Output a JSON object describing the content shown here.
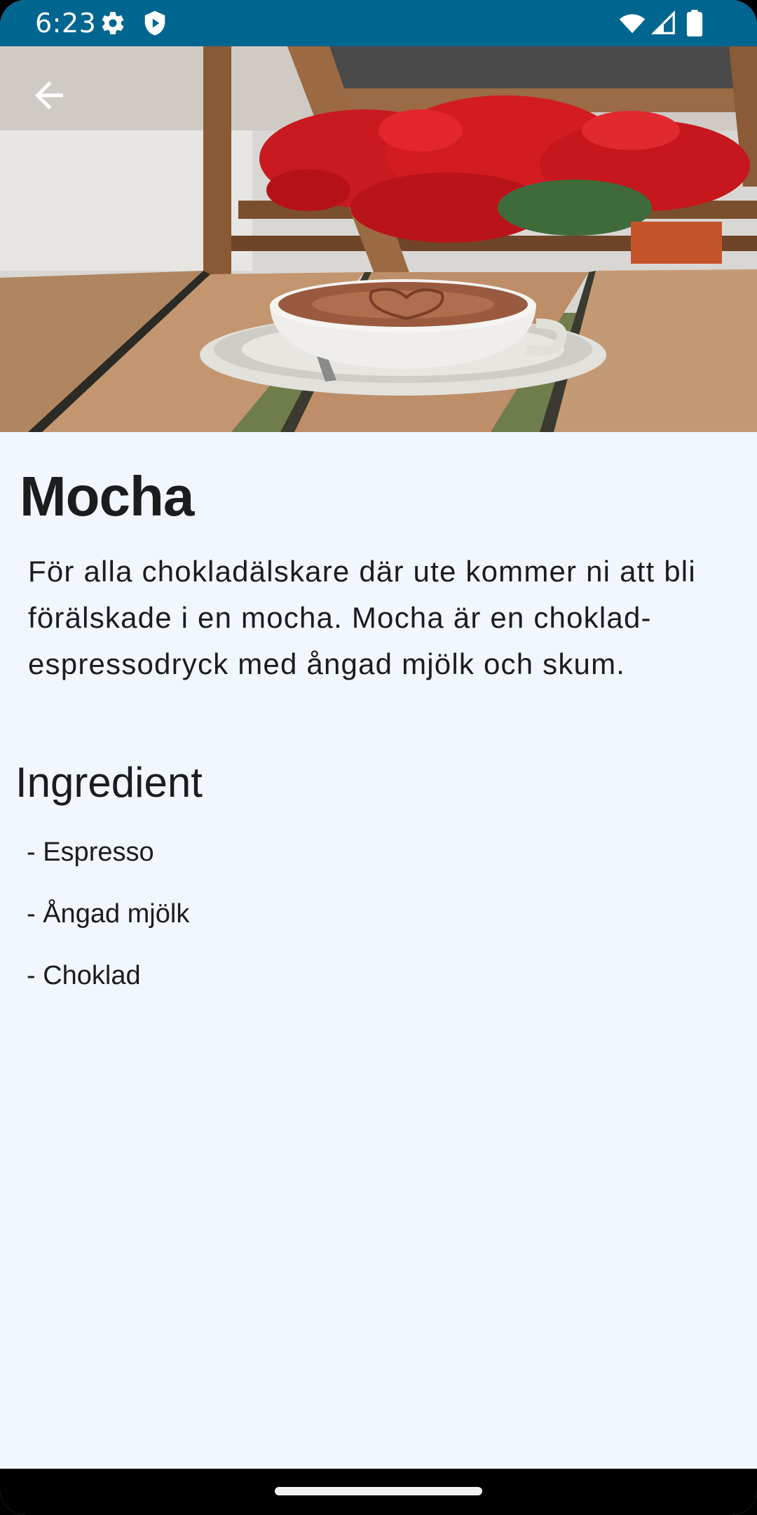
{
  "status_bar": {
    "time": "6:23",
    "icons": [
      "gear-icon",
      "shield-icon",
      "wifi-icon",
      "cellular-signal-icon",
      "battery-icon"
    ],
    "background": "#006690"
  },
  "hero": {
    "image": "mocha-cup-photo",
    "back_icon": "arrow-back-icon"
  },
  "content": {
    "title": "Mocha",
    "description": "För alla chokladälskare där ute kommer ni att bli förälskade i en mocha. Mocha är en choklad-espressodryck med ångad mjölk och skum.",
    "section_title": "Ingredient",
    "ingredients": [
      "- Espresso",
      "- Ångad mjölk",
      "- Choklad"
    ]
  },
  "colors": {
    "page_background": "#f1f7fd",
    "text": "#1a1c1e"
  }
}
